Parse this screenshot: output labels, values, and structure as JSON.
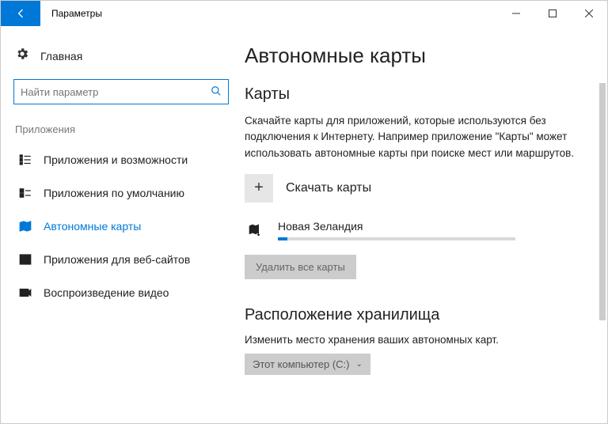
{
  "window": {
    "title": "Параметры"
  },
  "sidebar": {
    "home": "Главная",
    "searchPlaceholder": "Найти параметр",
    "section": "Приложения",
    "items": [
      {
        "label": "Приложения и возможности"
      },
      {
        "label": "Приложения по умолчанию"
      },
      {
        "label": "Автономные карты"
      },
      {
        "label": "Приложения для веб-сайтов"
      },
      {
        "label": "Воспроизведение видео"
      }
    ]
  },
  "main": {
    "title": "Автономные карты",
    "mapsHeader": "Карты",
    "description": "Скачайте карты для приложений, которые используются без подключения к Интернету. Например приложение \"Карты\" может использовать автономные карты при поиске мест или маршрутов.",
    "downloadLabel": "Скачать карты",
    "mapEntry": "Новая Зеландия",
    "deleteAll": "Удалить все карты",
    "storageHeader": "Расположение хранилища",
    "storageDesc": "Изменить место хранения ваших автономных карт.",
    "storageSelect": "Этот компьютер (C:)"
  }
}
